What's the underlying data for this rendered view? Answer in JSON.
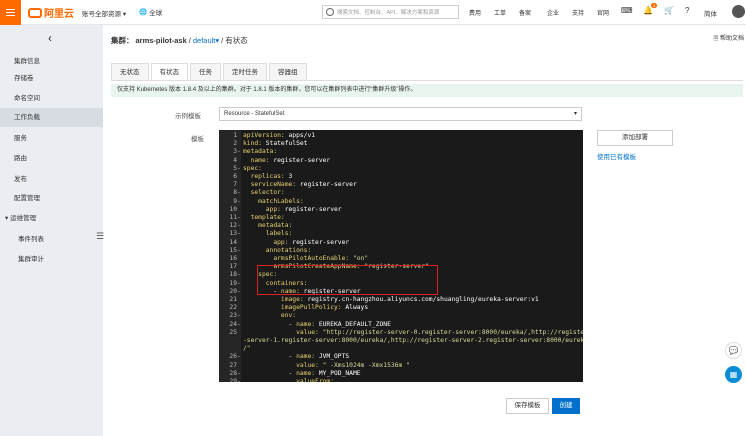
{
  "topbar": {
    "logo_text": "阿里云",
    "account_label": "账号全部资源",
    "region_label": "全球",
    "search_placeholder": "搜索文档、控制台、API、解决方案和资源",
    "links": [
      "费用",
      "工单",
      "备案",
      "企业",
      "支持",
      "官网"
    ],
    "notification_count": "3",
    "language": "简体"
  },
  "sidebar": {
    "items": [
      "集群信息",
      "存储卷",
      "命名空间",
      "工作负载",
      "服务",
      "路由",
      "发布",
      "配置管理",
      "运维管理",
      "事件列表",
      "集群审计"
    ],
    "active": "工作负载"
  },
  "breadcrumb": {
    "prefix": "集群：",
    "cluster": "arms-pilot-ask",
    "namespace": "default",
    "page": "有状态"
  },
  "help_label": "帮助文档",
  "tabs": [
    "无状态",
    "有状态",
    "任务",
    "定时任务",
    "容器组"
  ],
  "active_tab": "有状态",
  "notice": "仅支持 Kubernetes 版本 1.8.4 及以上的集群。对于 1.8.1 版本的集群，您可以在集群列表中进行“集群升级”操作。",
  "form": {
    "template_label": "示例模板",
    "template_value": "Resource - StatefulSet",
    "yaml_label": "模板"
  },
  "code_lines": [
    {
      "n": "1",
      "fold": "",
      "text": "apiVersion: apps/v1"
    },
    {
      "n": "2",
      "fold": "",
      "text": "kind: StatefulSet"
    },
    {
      "n": "3",
      "fold": "-",
      "text": "metadata:"
    },
    {
      "n": "4",
      "fold": "",
      "text": "  name: register-server"
    },
    {
      "n": "5",
      "fold": "-",
      "text": "spec:"
    },
    {
      "n": "6",
      "fold": "",
      "text": "  replicas: 3"
    },
    {
      "n": "7",
      "fold": "",
      "text": "  serviceName: register-server"
    },
    {
      "n": "8",
      "fold": "-",
      "text": "  selector:"
    },
    {
      "n": "9",
      "fold": "-",
      "text": "    matchLabels:"
    },
    {
      "n": "10",
      "fold": "",
      "text": "      app: register-server"
    },
    {
      "n": "11",
      "fold": "-",
      "text": "  template:"
    },
    {
      "n": "12",
      "fold": "-",
      "text": "    metadata:"
    },
    {
      "n": "13",
      "fold": "-",
      "text": "      labels:"
    },
    {
      "n": "14",
      "fold": "",
      "text": "        app: register-server"
    },
    {
      "n": "15",
      "fold": "-",
      "text": "      annotations:"
    },
    {
      "n": "16",
      "fold": "",
      "text": "        armsPilotAutoEnable: \"on\""
    },
    {
      "n": "17",
      "fold": "",
      "text": "        armsPilotCreateAppName: \"register-server\""
    },
    {
      "n": "18",
      "fold": "-",
      "text": "    spec:"
    },
    {
      "n": "19",
      "fold": "-",
      "text": "      containers:"
    },
    {
      "n": "20",
      "fold": "-",
      "text": "        - name: register-server"
    },
    {
      "n": "21",
      "fold": "",
      "text": "          image: registry.cn-hangzhou.aliyuncs.com/shuangling/eureka-server:v1"
    },
    {
      "n": "22",
      "fold": "",
      "text": "          imagePullPolicy: Always"
    },
    {
      "n": "23",
      "fold": "-",
      "text": "          env:"
    },
    {
      "n": "24",
      "fold": "-",
      "text": "            - name: EUREKA_DEFAULT_ZONE"
    },
    {
      "n": "25",
      "fold": "",
      "text": "              value: \"http://register-server-0.register-server:8000/eureka/,http://register"
    },
    {
      "n": "",
      "fold": "",
      "text": "-server-1.register-server:8000/eureka/,http://register-server-2.register-server:8000/eureka"
    },
    {
      "n": "",
      "fold": "",
      "text": "/\""
    },
    {
      "n": "26",
      "fold": "-",
      "text": "            - name: JVM_OPTS"
    },
    {
      "n": "27",
      "fold": "",
      "text": "              value: \" -Xms1024m -Xmx1536m \""
    },
    {
      "n": "28",
      "fold": "-",
      "text": "            - name: MY_POD_NAME"
    },
    {
      "n": "29",
      "fold": "-",
      "text": "              valueFrom:"
    }
  ],
  "side_actions": {
    "add_deploy": "添加部署",
    "use_existing": "使用已有模板"
  },
  "buttons": {
    "save_template": "保存模板",
    "create": "创建"
  }
}
